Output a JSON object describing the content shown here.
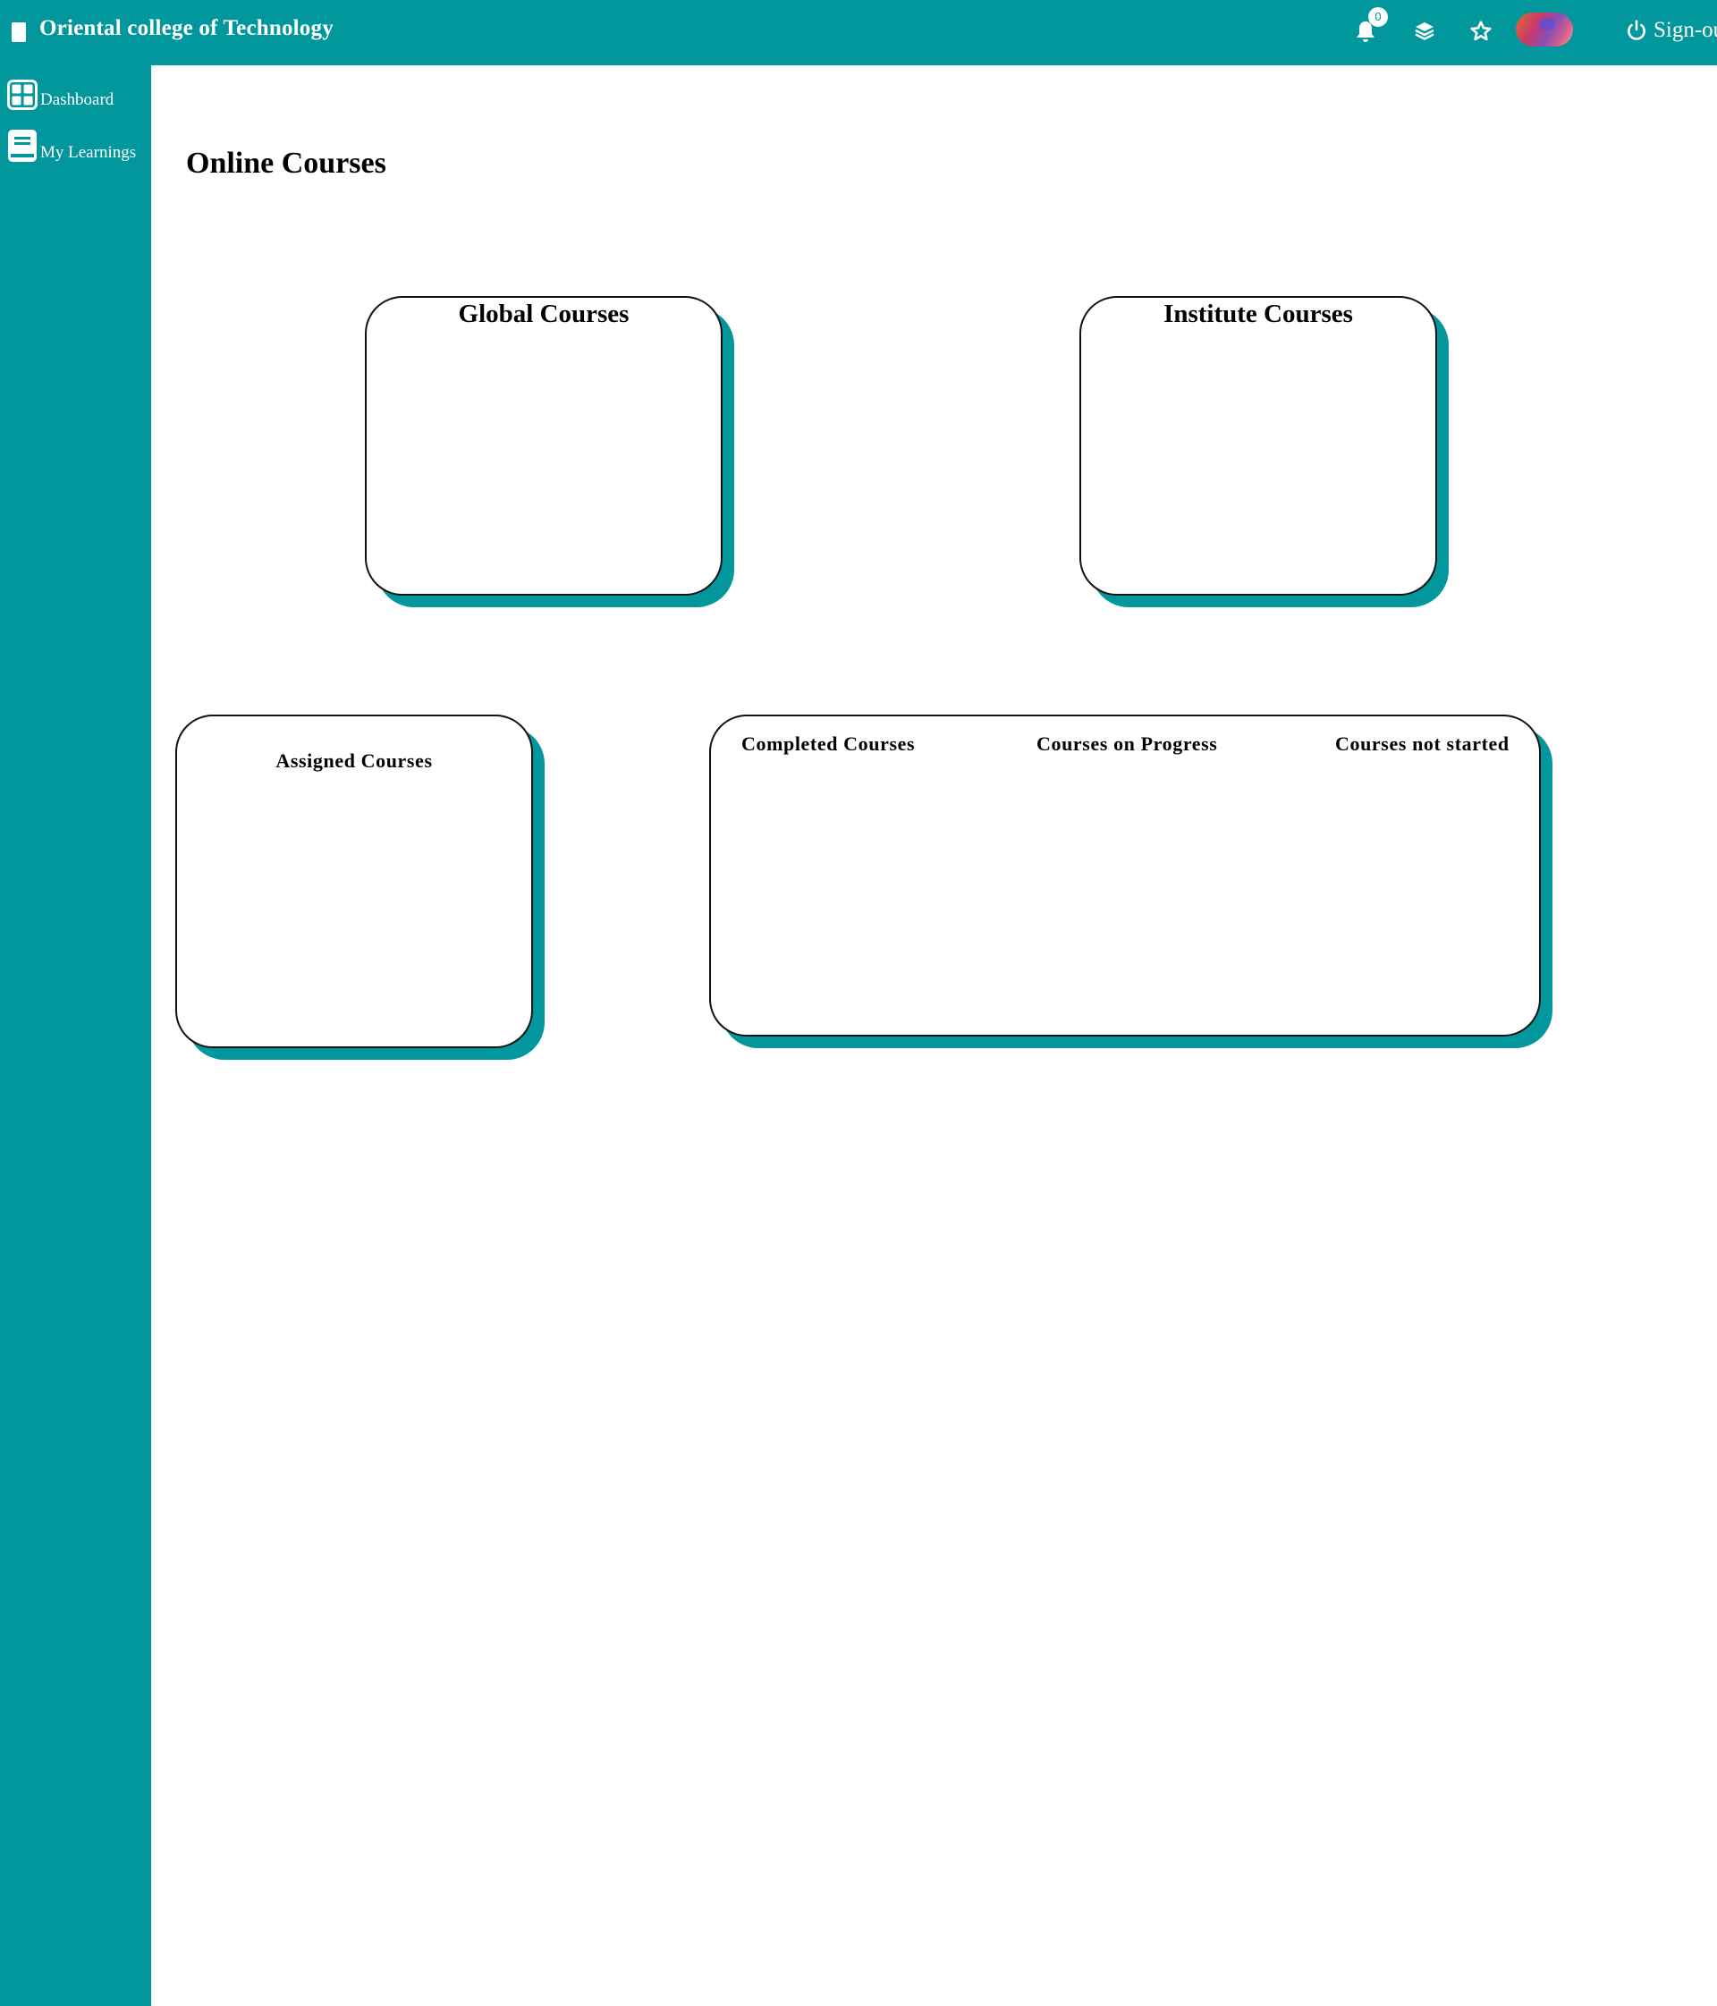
{
  "header": {
    "title": "Oriental college of Technology",
    "notification_count": "0",
    "signout_label": "Sign-ou",
    "icons": [
      "document-icon",
      "bell-icon",
      "layers-icon",
      "star-icon",
      "avatar",
      "power-icon"
    ],
    "background_color": "#02979c"
  },
  "sidebar": {
    "items": [
      {
        "label": "Dashboard",
        "icon": "dashboard-grid-icon"
      },
      {
        "label": "My Learnings",
        "icon": "book-icon"
      }
    ]
  },
  "main": {
    "title": "Online Courses",
    "cards": {
      "global": "Global Courses",
      "institute": "Institute Courses",
      "assigned": "Assigned Courses",
      "completed": "Completed Courses",
      "on_progress": "Courses on Progress",
      "not_started": "Courses not started"
    },
    "accent_color": "#02979c"
  }
}
